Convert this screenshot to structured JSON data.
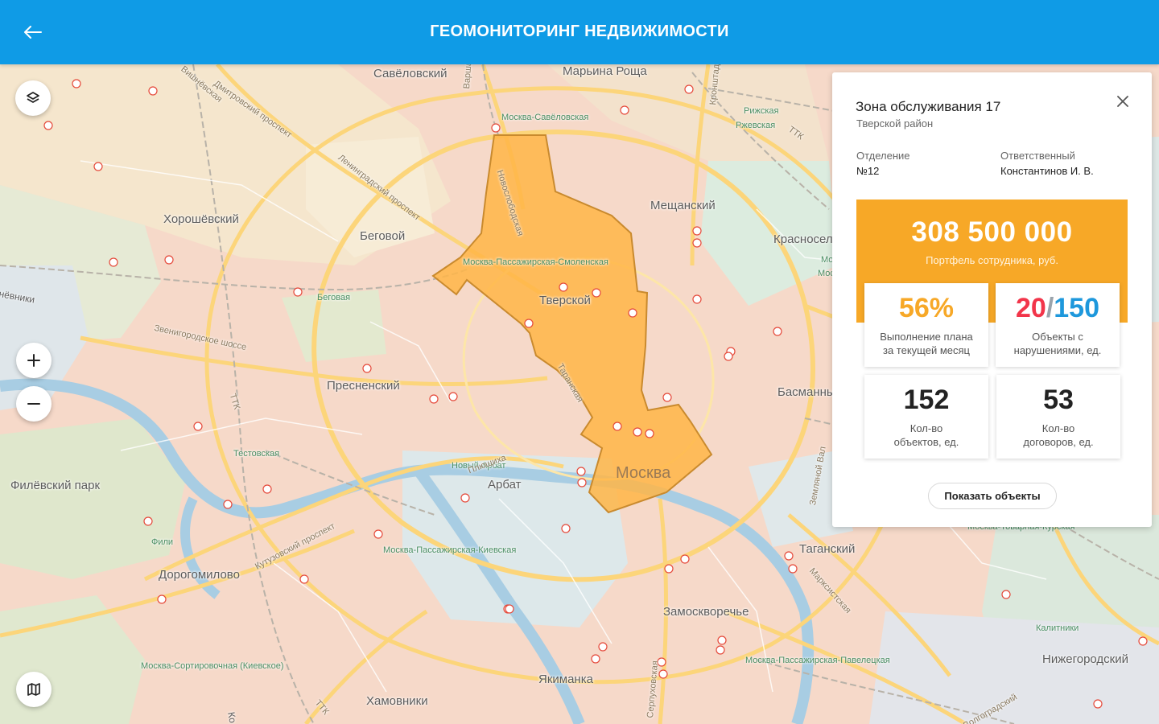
{
  "header": {
    "title": "ГЕОМОНИТОРИНГ НЕДВИЖИМОСТИ",
    "back_icon": "arrow-left-icon"
  },
  "map": {
    "districts": [
      "Савёловский",
      "Марьина Роща",
      "Хорошёвский",
      "Беговой",
      "Мещанский",
      "Красносел",
      "Тверской",
      "Пресненский",
      "Басманны",
      "Арбат",
      "Филёвский парк",
      "Дорогомилово",
      "Таганский",
      "Замоскворечье",
      "Якиманка",
      "Хамовники",
      "Нижегородский"
    ],
    "city_label": "Москва",
    "stations": [
      "Москва-Савёловская",
      "Рижская",
      "Ржевская",
      "Беговая",
      "Москва-Пассажирская-Смоленская",
      "Тестовская",
      "Новый Арбат",
      "Фили",
      "Москва-Пассажирская-Киевская",
      "Москва-Сортировочная (Киевское)",
      "Москва-Пассажирская-Павелецкая",
      "Калитники",
      "Москва-Товарная-Курская",
      "Моск",
      "Москва-"
    ],
    "roads": [
      "Дмитровский проспект",
      "Ленинградский проспект",
      "Звенигородское шоссе",
      "Кутузовский проспект",
      "Новослободская",
      "Марксистская",
      "Земляной Вал",
      "Волгоградский",
      "Вишнёвская",
      "ТТК",
      "ТТК",
      "ТТК",
      "Кронштадтский проспект",
      "Таранская",
      "Серпуховская",
      "Плющиха",
      "Варшавское"
    ],
    "edge_labels": [
      "нёвники",
      "Ко"
    ],
    "highlight_zone_color": "#ffb547"
  },
  "controls": {
    "layers_icon": "layers-icon",
    "zoom_in_icon": "plus-icon",
    "zoom_out_icon": "minus-icon",
    "map_icon": "map-icon"
  },
  "panel": {
    "title": "Зона обслуживания 17",
    "subtitle": "Тверской район",
    "close_icon": "close-icon",
    "branch_label": "Отделение",
    "branch_value": "№12",
    "responsible_label": "Ответственный",
    "responsible_value": "Константинов И. В.",
    "portfolio_value": "308 500 000",
    "portfolio_label": "Портфель сотрудника, руб.",
    "plan_value": "56%",
    "plan_label_1": "Выполнение плана",
    "plan_label_2": "за текущей месяц",
    "violations_value": "20",
    "violations_sep": "/",
    "violations_total": "150",
    "violations_label_1": "Объекты с",
    "violations_label_2": "нарушениями, ед.",
    "objects_value": "152",
    "objects_label_1": "Кол-во",
    "objects_label_2": "объектов, ед.",
    "contracts_value": "53",
    "contracts_label_1": "Кол-во",
    "contracts_label_2": "договоров, ед.",
    "show_button": "Показать объекты",
    "accent_orange": "#f7a827",
    "accent_red": "#f2354a",
    "accent_blue": "#1e98dc"
  }
}
